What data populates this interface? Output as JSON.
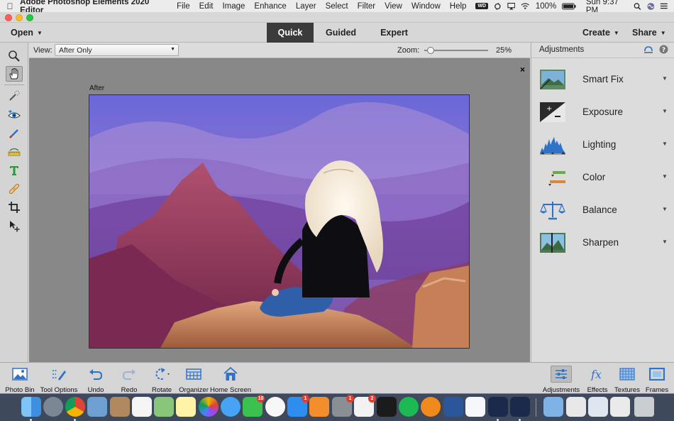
{
  "menubar": {
    "app_name": "Adobe Photoshop Elements 2020 Editor",
    "items": [
      "File",
      "Edit",
      "Image",
      "Enhance",
      "Layer",
      "Select",
      "Filter",
      "View",
      "Window",
      "Help"
    ],
    "wd_badge": "WD",
    "battery": "100%",
    "clock": "Sun 9:37 PM"
  },
  "topbar": {
    "open_label": "Open",
    "modes": [
      "Quick",
      "Guided",
      "Expert"
    ],
    "active_mode": "Quick",
    "create_label": "Create",
    "share_label": "Share"
  },
  "options": {
    "view_label": "View:",
    "view_value": "After Only",
    "zoom_label": "Zoom:",
    "zoom_value": "25%",
    "zoom_fraction": 0.05
  },
  "canvas": {
    "after_label": "After",
    "close_glyph": "×"
  },
  "panel": {
    "title": "Adjustments",
    "items": [
      {
        "label": "Smart Fix"
      },
      {
        "label": "Exposure"
      },
      {
        "label": "Lighting"
      },
      {
        "label": "Color"
      },
      {
        "label": "Balance"
      },
      {
        "label": "Sharpen"
      }
    ]
  },
  "bottombar": {
    "left": [
      "Photo Bin",
      "Tool Options",
      "Undo",
      "Redo",
      "Rotate",
      "Organizer",
      "Home Screen"
    ],
    "right": [
      "Adjustments",
      "Effects",
      "Textures",
      "Frames"
    ],
    "selected": "Adjustments"
  },
  "dock": {
    "badges": [
      "10",
      "1",
      "1",
      "2"
    ]
  },
  "colors": {
    "active_mode_bg": "#3b3b3b",
    "canvas_bg": "#888888",
    "dock_bg": "#3e4a5c"
  }
}
